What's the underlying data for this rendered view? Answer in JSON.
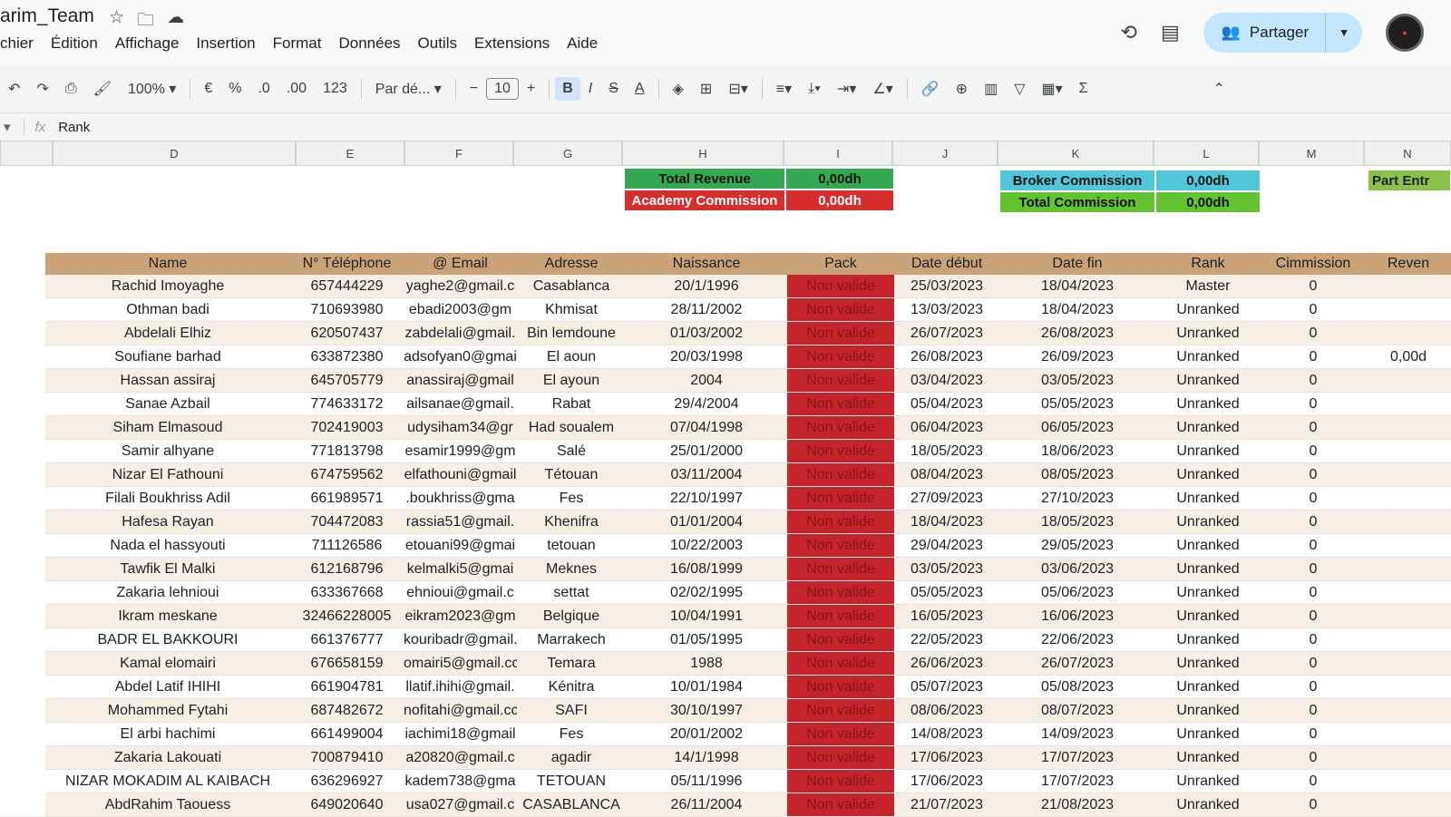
{
  "title": "arim_Team",
  "menu": [
    "chier",
    "Édition",
    "Affichage",
    "Insertion",
    "Format",
    "Données",
    "Outils",
    "Extensions",
    "Aide"
  ],
  "share_label": "Partager",
  "toolbar": {
    "zoom": "100%",
    "currency": "€",
    "percent": "%",
    "dec_less": ".0",
    "dec_more": ".00",
    "number_format": "123",
    "font": "Par dé...",
    "font_size": "10",
    "bold": "B",
    "italic": "I",
    "strike": "S",
    "text_color": "A"
  },
  "formula_bar": {
    "fx": "fx",
    "value": "Rank"
  },
  "columns": [
    "D",
    "E",
    "F",
    "G",
    "H",
    "I",
    "J",
    "K",
    "L",
    "M",
    "N"
  ],
  "summary": {
    "total_revenue_label": "Total Revenue",
    "total_revenue_value": "0,00dh",
    "academy_label": "Academy Commission",
    "academy_value": "0,00dh",
    "broker_label": "Broker Commission",
    "broker_value": "0,00dh",
    "total_commission_label": "Total Commission",
    "total_commission_value": "0,00dh",
    "part_label": "Part Entr"
  },
  "headers": [
    "Name",
    "N° Téléphone",
    "@ Email",
    "Adresse",
    "Naissance",
    "Pack",
    "Date début",
    "Date fin",
    "Rank",
    "Cimmission",
    "Reven"
  ],
  "rows": [
    [
      "Rachid Imoyaghe",
      "657444229",
      "yaghe2@gmail.c",
      "Casablanca",
      "20/1/1996",
      "Non valide",
      "25/03/2023",
      "18/04/2023",
      "Master",
      "0",
      ""
    ],
    [
      "Othman badi",
      "710693980",
      "ebadi2003@gm",
      "Khmisat",
      "28/11/2002",
      "Non valide",
      "13/03/2023",
      "18/04/2023",
      "Unranked",
      "0",
      ""
    ],
    [
      "Abdelali Elhiz",
      "620507437",
      "zabdelali@gmail.",
      "Bin lemdoune",
      "01/03/2002",
      "Non valide",
      "26/07/2023",
      "26/08/2023",
      "Unranked",
      "0",
      ""
    ],
    [
      "Soufiane barhad",
      "633872380",
      "adsofyan0@gmai",
      "El aoun",
      "20/03/1998",
      "Non valide",
      "26/08/2023",
      "26/09/2023",
      "Unranked",
      "0",
      "0,00d"
    ],
    [
      "Hassan assiraj",
      "645705779",
      "anassiraj@gmail",
      "El ayoun",
      "2004",
      "Non valide",
      "03/04/2023",
      "03/05/2023",
      "Unranked",
      "0",
      ""
    ],
    [
      "Sanae Azbail",
      "774633172",
      "ailsanae@gmail.",
      "Rabat",
      "29/4/2004",
      "Non valide",
      "05/04/2023",
      "05/05/2023",
      "Unranked",
      "0",
      ""
    ],
    [
      "Siham Elmasoud",
      "702419003",
      "udysiham34@gr",
      "Had soualem",
      "07/04/1998",
      "Non valide",
      "06/04/2023",
      "06/05/2023",
      "Unranked",
      "0",
      ""
    ],
    [
      "Samir alhyane",
      "771813798",
      "esamir1999@gm",
      "Salé",
      "25/01/2000",
      "Non valide",
      "18/05/2023",
      "18/06/2023",
      "Unranked",
      "0",
      ""
    ],
    [
      "Nizar El Fathouni",
      "674759562",
      "elfathouni@gmail",
      "Tétouan",
      "03/11/2004",
      "Non valide",
      "08/04/2023",
      "08/05/2023",
      "Unranked",
      "0",
      ""
    ],
    [
      "Filali Boukhriss Adil",
      "661989571",
      ".boukhriss@gma",
      "Fes",
      "22/10/1997",
      "Non valide",
      "27/09/2023",
      "27/10/2023",
      "Unranked",
      "0",
      ""
    ],
    [
      "Hafesa Rayan",
      "704472083",
      "rassia51@gmail.",
      "Khenifra",
      "01/01/2004",
      "Non valide",
      "18/04/2023",
      "18/05/2023",
      "Unranked",
      "0",
      ""
    ],
    [
      "Nada el hassyouti",
      "711126586",
      "etouani99@gmai",
      "tetouan",
      "10/22/2003",
      "Non valide",
      "29/04/2023",
      "29/05/2023",
      "Unranked",
      "0",
      ""
    ],
    [
      "Tawfik El Malki",
      "612168796",
      "kelmalki5@gmai",
      "Meknes",
      "16/08/1999",
      "Non valide",
      "03/05/2023",
      "03/06/2023",
      "Unranked",
      "0",
      ""
    ],
    [
      "Zakaria lehnioui",
      "633367668",
      "ehnioui@gmail.c",
      "settat",
      "02/02/1995",
      "Non valide",
      "05/05/2023",
      "05/06/2023",
      "Unranked",
      "0",
      ""
    ],
    [
      "Ikram meskane",
      "32466228005",
      "eikram2023@gm",
      "Belgique",
      "10/04/1991",
      "Non valide",
      "16/05/2023",
      "16/06/2023",
      "Unranked",
      "0",
      ""
    ],
    [
      "BADR EL BAKKOURI",
      "661376777",
      "kouribadr@gmail.",
      "Marrakech",
      "01/05/1995",
      "Non valide",
      "22/05/2023",
      "22/06/2023",
      "Unranked",
      "0",
      ""
    ],
    [
      "Kamal elomairi",
      "676658159",
      "omairi5@gmail.cc",
      "Temara",
      "1988",
      "Non valide",
      "26/06/2023",
      "26/07/2023",
      "Unranked",
      "0",
      ""
    ],
    [
      "Abdel Latif IHIHI",
      "661904781",
      "llatif.ihihi@gmail.",
      "Kénitra",
      "10/01/1984",
      "Non valide",
      "05/07/2023",
      "05/08/2023",
      "Unranked",
      "0",
      ""
    ],
    [
      "Mohammed Fytahi",
      "687482672",
      "nofitahi@gmail.cc",
      "SAFI",
      "30/10/1997",
      "Non valide",
      "08/06/2023",
      "08/07/2023",
      "Unranked",
      "0",
      ""
    ],
    [
      "El arbi hachimi",
      "661499004",
      "iachimi18@gmail",
      "Fes",
      "20/01/2002",
      "Non valide",
      "14/08/2023",
      "14/09/2023",
      "Unranked",
      "0",
      ""
    ],
    [
      "Zakaria Lakouati",
      "700879410",
      "a20820@gmail.c",
      "agadir",
      "14/1/1998",
      "Non valide",
      "17/06/2023",
      "17/07/2023",
      "Unranked",
      "0",
      ""
    ],
    [
      "NIZAR MOKADIM AL KAIBACH",
      "636296927",
      "kadem738@gma",
      "TETOUAN",
      "05/11/1996",
      "Non valide",
      "17/06/2023",
      "17/07/2023",
      "Unranked",
      "0",
      ""
    ],
    [
      "AbdRahim Taouess",
      "649020640",
      "usa027@gmail.c",
      "CASABLANCA",
      "26/11/2004",
      "Non valide",
      "21/07/2023",
      "21/08/2023",
      "Unranked",
      "0",
      ""
    ]
  ]
}
